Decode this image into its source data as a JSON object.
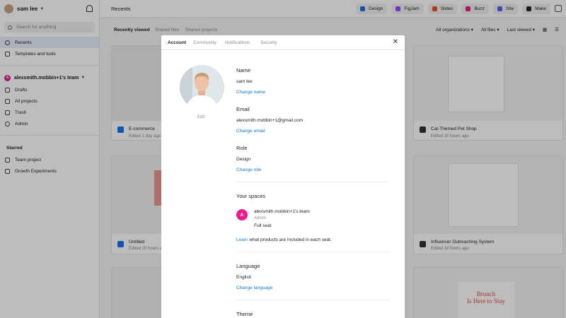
{
  "sidebar": {
    "user_name": "sam lee",
    "search_placeholder": "Search for anything",
    "nav": [
      "Recents",
      "Templates and tools"
    ],
    "team_initial": "A",
    "team_name": "alexsmith.mobbin+1's team",
    "team_items": [
      "Drafts",
      "All projects",
      "Trash",
      "Admin"
    ],
    "starred_label": "Starred",
    "starred_items": [
      "Team project",
      "Growth Experiments"
    ]
  },
  "topbar": {
    "title": "Recents",
    "apps": [
      {
        "label": "Design",
        "color": "#1a73e8"
      },
      {
        "label": "FigJam",
        "color": "#9747ff"
      },
      {
        "label": "Slides",
        "color": "#f24e1e"
      },
      {
        "label": "Buzz",
        "color": "#e91e8c"
      },
      {
        "label": "Site",
        "color": "#5c5ff5"
      },
      {
        "label": "Make",
        "color": "#222222"
      }
    ]
  },
  "subbar": {
    "tabs": [
      "Recently viewed",
      "Shared files",
      "Shared projects"
    ],
    "filters": [
      "All organizations",
      "All files",
      "Last viewed"
    ]
  },
  "cards": [
    {
      "title": "E-commerce",
      "sub": "Edited 1 day ago"
    },
    {
      "title": "Cat-Themed Pet Shop",
      "sub": "Edited 20 hours ago"
    },
    {
      "title": "Untitled",
      "sub": "Edited 20 hours ago"
    },
    {
      "title": "Influencer Outreaching System",
      "sub": "Edited 18 hours ago"
    }
  ],
  "card_thumb_text": [
    "Brunch",
    "Is Here to Stay"
  ],
  "modal": {
    "tabs": [
      "Account",
      "Community",
      "Notifications",
      "Security"
    ],
    "edit_label": "Edit",
    "name": {
      "label": "Name",
      "value": "sam lee",
      "action": "Change name"
    },
    "email": {
      "label": "Email",
      "value": "alexsmith.mobbin+1@gmail.com",
      "action": "Change email"
    },
    "role": {
      "label": "Role",
      "value": "Design",
      "action": "Change role"
    },
    "spaces": {
      "label": "Your spaces",
      "initial": "A",
      "team": "alexsmith.mobbin+1's team",
      "team_role": "Admin",
      "seat": "Full seat",
      "learn_link": "Learn",
      "learn_rest": " what products are included in each seat."
    },
    "language": {
      "label": "Language",
      "value": "English",
      "action": "Change language"
    },
    "theme_label": "Theme"
  }
}
